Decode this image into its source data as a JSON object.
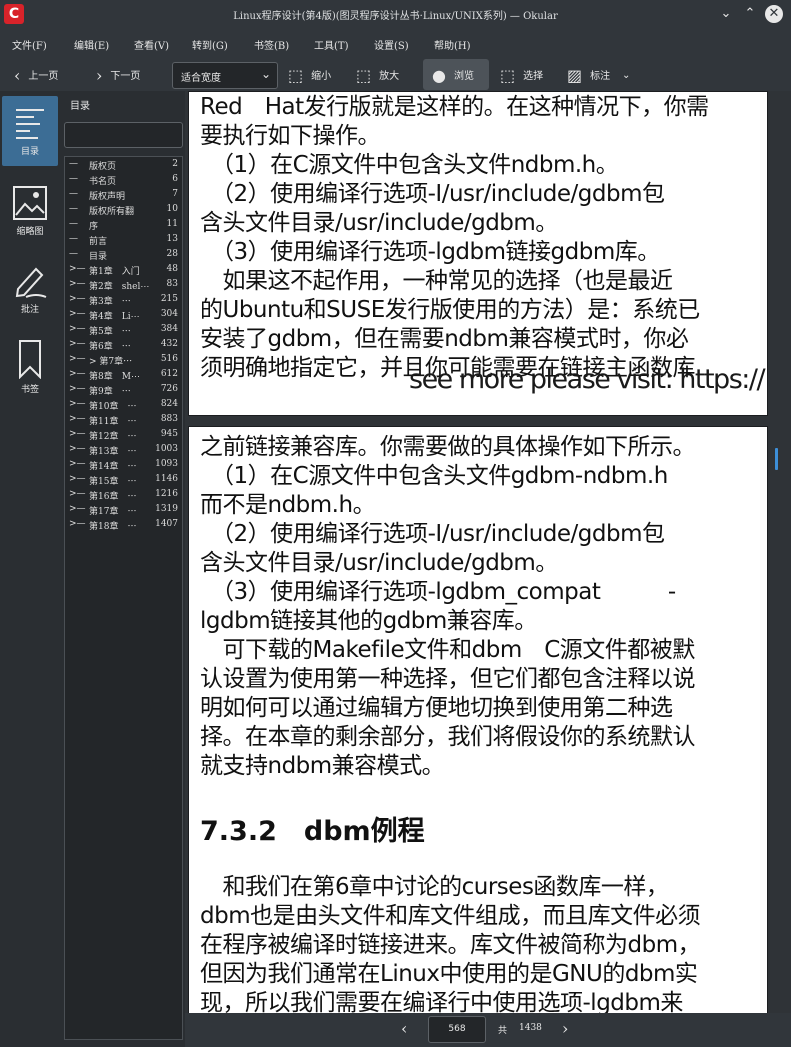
{
  "window": {
    "title": "Linux程序设计(第4版)(图灵程序设计丛书·Linux/UNIX系列) — Okular",
    "app_icon": "okular-icon"
  },
  "menubar": [
    "文件(F)",
    "编辑(E)",
    "查看(V)",
    "转到(G)",
    "书签(B)",
    "工具(T)",
    "设置(S)",
    "帮助(H)"
  ],
  "toolbar": {
    "prev_page": "上一页",
    "next_page": "下一页",
    "zoom_value": "适合宽度",
    "zoom_out": "缩小",
    "zoom_in": "放大",
    "browse": "浏览",
    "selection": "选择",
    "annotate": "标注"
  },
  "sidebar": {
    "items": [
      {
        "label": "目录",
        "icon": "table-of-contents-icon",
        "active": true
      },
      {
        "label": "缩略图",
        "icon": "thumbnails-icon",
        "active": false
      },
      {
        "label": "批注",
        "icon": "annotations-icon",
        "active": false
      },
      {
        "label": "书签",
        "icon": "bookmark-icon",
        "active": false
      }
    ]
  },
  "toc": {
    "header": "目录",
    "entries": [
      {
        "expander": "—",
        "label": "版权页",
        "page": "2"
      },
      {
        "expander": "—",
        "label": "书名页",
        "page": "6"
      },
      {
        "expander": "—",
        "label": "版权声明",
        "page": "7"
      },
      {
        "expander": "—",
        "label": "版权所有翻",
        "page": "10"
      },
      {
        "expander": "—",
        "label": "序",
        "page": "11"
      },
      {
        "expander": "—",
        "label": "前言",
        "page": "13"
      },
      {
        "expander": "—",
        "label": "目录",
        "page": "28"
      },
      {
        "expander": ">—",
        "label": "第1章　入门",
        "page": "48"
      },
      {
        "expander": ">—",
        "label": "第2章　shel⋯",
        "page": "83"
      },
      {
        "expander": ">—",
        "label": "第3章　⋯",
        "page": "215"
      },
      {
        "expander": ">—",
        "label": "第4章　Li⋯",
        "page": "304"
      },
      {
        "expander": ">—",
        "label": "第5章　⋯",
        "page": "384"
      },
      {
        "expander": ">—",
        "label": "第6章　⋯",
        "page": "432"
      },
      {
        "expander": ">—",
        "label": "> 第7章⋯",
        "page": "516"
      },
      {
        "expander": ">—",
        "label": "第8章　M⋯",
        "page": "612"
      },
      {
        "expander": ">—",
        "label": "第9章　⋯",
        "page": "726"
      },
      {
        "expander": ">—",
        "label": "第10章　⋯",
        "page": "824"
      },
      {
        "expander": ">—",
        "label": "第11章　⋯",
        "page": "883"
      },
      {
        "expander": ">—",
        "label": "第12章　⋯",
        "page": "945"
      },
      {
        "expander": ">—",
        "label": "第13章　⋯",
        "page": "1003"
      },
      {
        "expander": ">—",
        "label": "第14章　⋯",
        "page": "1093"
      },
      {
        "expander": ">—",
        "label": "第15章　⋯",
        "page": "1146"
      },
      {
        "expander": ">—",
        "label": "第16章　⋯",
        "page": "1216"
      },
      {
        "expander": ">—",
        "label": "第17章　⋯",
        "page": "1319"
      },
      {
        "expander": ">—",
        "label": "第18章　⋯",
        "page": "1407"
      }
    ]
  },
  "document": {
    "page1_lines": [
      "Red　Hat发行版就是这样的。在这种情况下，你需",
      "要执行如下操作。",
      "　（1）在C源文件中包含头文件ndbm.h。",
      "　（2）使用编译行选项-I/usr/include/gdbm包",
      "含头文件目录/usr/include/gdbm。",
      "　（3）使用编译行选项-lgdbm链接gdbm库。",
      "　如果这不起作用，一种常见的选择（也是最近",
      "的Ubuntu和SUSE发行版使用的方法）是：系统已",
      "安装了gdbm，但在需要ndbm兼容模式时，你必",
      "须明确地指定它，并且你可能需要在链接主函数库"
    ],
    "watermark": "see more please visit: https://",
    "page2_lines": [
      "之前链接兼容库。你需要做的具体操作如下所示。",
      "　（1）在C源文件中包含头文件gdbm-ndbm.h",
      "而不是ndbm.h。",
      "　（2）使用编译行选项-I/usr/include/gdbm包",
      "含头文件目录/usr/include/gdbm。",
      "　（3）使用编译行选项-lgdbm_compat　　　-",
      "lgdbm链接其他的gdbm兼容库。",
      "　可下载的Makefile文件和dbm　C源文件都被默",
      "认设置为使用第一种选择，但它们都包含注释以说",
      "明如何可以通过编辑方便地切换到使用第二种选",
      "择。在本章的剩余部分，我们将假设你的系统默认",
      "就支持ndbm兼容模式。"
    ],
    "section_heading": "7.3.2　dbm例程",
    "page2_lines_after": [
      "　和我们在第6章中讨论的curses函数库一样，",
      "dbm也是由头文件和库文件组成，而且库文件必须",
      "在程序被编译时链接进来。库文件被简称为dbm，",
      "但因为我们通常在Linux中使用的是GNU的dbm实",
      "现，所以我们需要在编译行中使用选项-lgdbm来"
    ]
  },
  "pager": {
    "current_page": "568",
    "of_label": "共",
    "total_pages": "1438"
  }
}
